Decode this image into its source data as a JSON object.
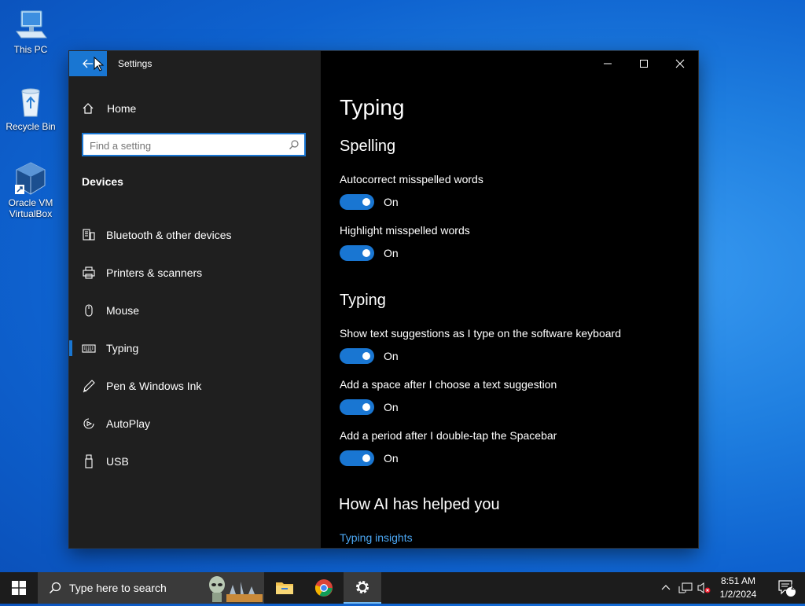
{
  "desktop": {
    "icons": [
      {
        "label": "This PC"
      },
      {
        "label": "Recycle Bin"
      },
      {
        "label": "Oracle VM VirtualBox"
      }
    ]
  },
  "window": {
    "title": "Settings",
    "sidebar": {
      "home_label": "Home",
      "search_placeholder": "Find a setting",
      "section_label": "Devices",
      "items": [
        {
          "label": "Bluetooth & other devices",
          "icon": "bluetooth-devices-icon"
        },
        {
          "label": "Printers & scanners",
          "icon": "printer-icon"
        },
        {
          "label": "Mouse",
          "icon": "mouse-icon"
        },
        {
          "label": "Typing",
          "icon": "keyboard-icon",
          "active": true
        },
        {
          "label": "Pen & Windows Ink",
          "icon": "pen-icon"
        },
        {
          "label": "AutoPlay",
          "icon": "autoplay-icon"
        },
        {
          "label": "USB",
          "icon": "usb-icon"
        }
      ]
    },
    "content": {
      "title": "Typing",
      "spelling_heading": "Spelling",
      "typing_heading": "Typing",
      "ai_heading": "How AI has helped you",
      "insights_link": "Typing insights",
      "settings": [
        {
          "label": "Autocorrect misspelled words",
          "state": "On"
        },
        {
          "label": "Highlight misspelled words",
          "state": "On"
        },
        {
          "label": "Show text suggestions as I type on the software keyboard",
          "state": "On"
        },
        {
          "label": "Add a space after I choose a text suggestion",
          "state": "On"
        },
        {
          "label": "Add a period after I double-tap the Spacebar",
          "state": "On"
        }
      ]
    }
  },
  "taskbar": {
    "search_placeholder": "Type here to search",
    "time": "8:51 AM",
    "date": "1/2/2024",
    "notification_count": "2"
  },
  "colors": {
    "accent": "#1976d2",
    "link": "#4ca8f5",
    "sidebar_bg": "#1f1f1f",
    "content_bg": "#000000"
  }
}
